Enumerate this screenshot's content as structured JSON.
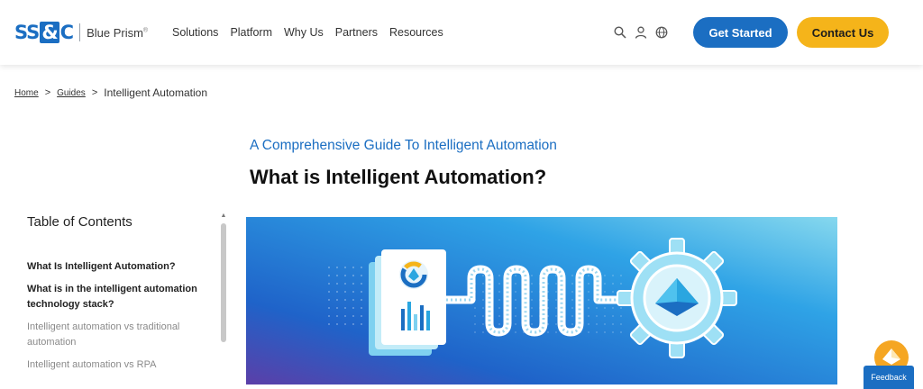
{
  "header": {
    "logo_mark_left": "SS",
    "logo_mark_amp": "&",
    "logo_mark_right": "C",
    "logo_text": "Blue Prism",
    "logo_reg": "®",
    "nav": [
      "Solutions",
      "Platform",
      "Why Us",
      "Partners",
      "Resources"
    ],
    "icons": [
      "search-icon",
      "user-icon",
      "globe-icon"
    ],
    "get_started": "Get Started",
    "contact_us": "Contact Us"
  },
  "breadcrumb": {
    "home": "Home",
    "sep1": ">",
    "guides": "Guides",
    "sep2": ">",
    "current": "Intelligent Automation"
  },
  "article": {
    "eyebrow": "A Comprehensive Guide To Intelligent Automation",
    "title": "What is Intelligent Automation?"
  },
  "toc": {
    "title": "Table of Contents",
    "items": [
      "What Is Intelligent Automation?",
      "What is in the intelligent automation technology stack?",
      "Intelligent automation vs traditional automation",
      "Intelligent automation vs RPA"
    ]
  },
  "widgets": {
    "feedback": "Feedback"
  },
  "colors": {
    "brand_blue": "#1b6ec2",
    "accent_yellow": "#f5b41a"
  }
}
